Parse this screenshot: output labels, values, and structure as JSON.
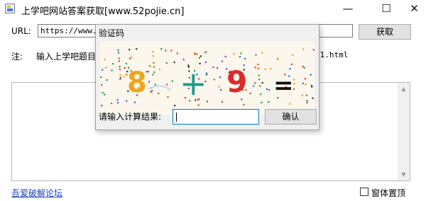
{
  "window": {
    "title": "上学吧网站答案获取[www.52pojie.cn]",
    "minimize": "—",
    "maximize": "☐",
    "close": "✕"
  },
  "form": {
    "url_label": "URL:",
    "url_value": "https://www.s                    /1/                    ",
    "get_button": "获取",
    "note_label": "注:",
    "note_text": "输入上学吧题目",
    "note_tail": "s1.html"
  },
  "footer": {
    "forum_link": "吾爱破解论坛",
    "topmost_label": "窗体置顶",
    "topmost_checked": false
  },
  "captcha_dialog": {
    "title": "验证码",
    "expression": {
      "left": "8",
      "operator": "+",
      "right": "9",
      "equals": "="
    },
    "colors": {
      "left": "#f0a51c",
      "operator": "#1b9c8e",
      "right": "#e02828",
      "equals": "#111111"
    },
    "answer_label": "请输入计算结果:",
    "answer_value": "",
    "confirm_button": "确认"
  }
}
